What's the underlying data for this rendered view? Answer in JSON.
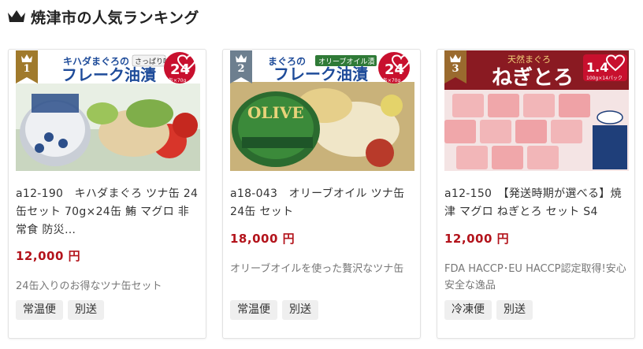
{
  "page": {
    "title": "焼津市の人気ランキング"
  },
  "colors": {
    "price": "#b3131b",
    "badge_gold": "#a07a2c",
    "badge_steel": "#6d7f8f",
    "badge_bronze": "#9a6a2e",
    "tag_bg": "#efefef"
  },
  "icons": {
    "header": "crown-icon",
    "favorite": "heart-icon"
  },
  "cards": [
    {
      "rank": "1",
      "image_text": {
        "top": "キハダまぐろの",
        "sub": "さっぱり味",
        "main": "フレーク油漬",
        "count": "24",
        "unit": "1缶×70g"
      },
      "name": "a12-190　キハダまぐろ ツナ缶 24缶セット 70g×24缶 鮪 マグロ 非常食 防災…",
      "price": "12,000 円",
      "description": "24缶入りのお得なツナ缶セット",
      "tags": [
        "常温便",
        "別送"
      ]
    },
    {
      "rank": "2",
      "image_text": {
        "top": "まぐろの",
        "sub": "オリーブオイル漬",
        "main": "フレーク油漬",
        "count": "24",
        "unit": "1缶×70g",
        "can": "OLIVE"
      },
      "name": "a18-043　オリーブオイル ツナ缶 24缶 セット",
      "price": "18,000 円",
      "description": "オリーブオイルを使った贅沢なツナ缶",
      "tags": [
        "常温便",
        "別送"
      ]
    },
    {
      "rank": "3",
      "image_text": {
        "top": "天然まぐろ",
        "main": "ねぎとろ",
        "count": "1.4",
        "unit": "100g×14パック"
      },
      "name": "a12-150　【発送時期が選べる】焼津 マグロ ねぎとろ セット S4",
      "price": "12,000 円",
      "description": "FDA HACCP･EU HACCP認定取得!安心安全な逸品",
      "tags": [
        "冷凍便",
        "別送"
      ]
    }
  ]
}
